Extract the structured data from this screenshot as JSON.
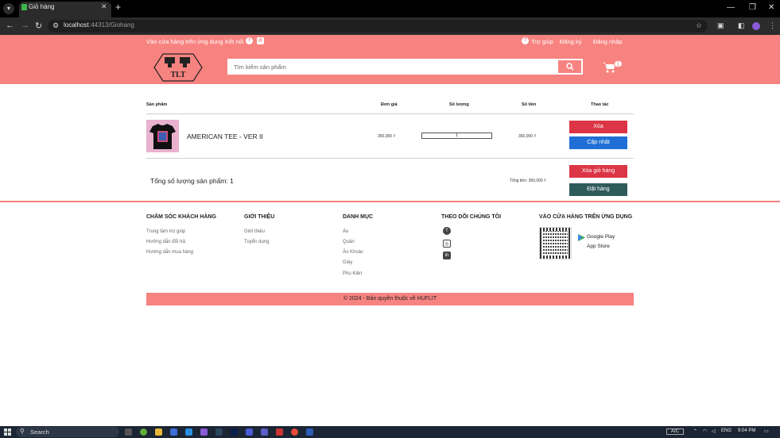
{
  "browser": {
    "tab_title": "Giỏ hàng",
    "url_host": "localhost",
    "url_path": ":44313/Giohang",
    "new_tab": "+",
    "close_tab": "✕"
  },
  "header": {
    "app_link": "Vào cửa hàng trên ứng dụng",
    "connect": "Kết nối",
    "help": "Trợ giúp",
    "register": "Đăng ký",
    "login": "Đăng nhập",
    "search_placeholder": "Tìm kiếm sản phẩm",
    "cart_count": "1",
    "logo_text": "TLT"
  },
  "cart": {
    "columns": [
      "Sản phẩm",
      "Đơn giá",
      "Số lượng",
      "Số tiền",
      "Thao tác"
    ],
    "item": {
      "name": "AMERICAN TEE - VER II",
      "price": "350,000 ₫",
      "quantity": "1",
      "total": "350,000 ₫",
      "delete_label": "Xóa",
      "update_label": "Cập nhật"
    },
    "total_quantity": "Tổng số lượng sản phẩm: 1",
    "total_amount": "Tổng tiền: 350,000 ₫",
    "clear_label": "Xóa giỏ hàng",
    "order_label": "Đặt hàng"
  },
  "footer": {
    "customer_care": {
      "title": "CHĂM SÓC KHÁCH HÀNG",
      "links": [
        "Trung tâm trợ giúp",
        "Hướng dẫn đổi trả",
        "Hướng dẫn mua hàng"
      ]
    },
    "about": {
      "title": "GIỚI THIỆU",
      "links": [
        "Giới thiệu",
        "Tuyển dụng"
      ]
    },
    "categories": {
      "title": "DANH MỤC",
      "links": [
        "Áo",
        "Quần",
        "Áo Khoác",
        "Giày",
        "Phụ Kiện"
      ]
    },
    "follow": {
      "title": "THEO DÕI CHÚNG TÔI"
    },
    "app": {
      "title": "VÀO CỬA HÀNG TRÊN ỨNG DỤNG",
      "google_play": "Google Play",
      "app_store": "App Store"
    },
    "copyright": "© 2024 - Bản quyền thuộc về HUFLIT"
  },
  "taskbar": {
    "search": "Search",
    "ac": "A/C",
    "lang": "ENG",
    "time": "9:04 PM"
  },
  "colors": {
    "brand": "#f78380",
    "danger": "#dc3545",
    "primary": "#1f6fd6",
    "dark": "#2f5a5a"
  }
}
